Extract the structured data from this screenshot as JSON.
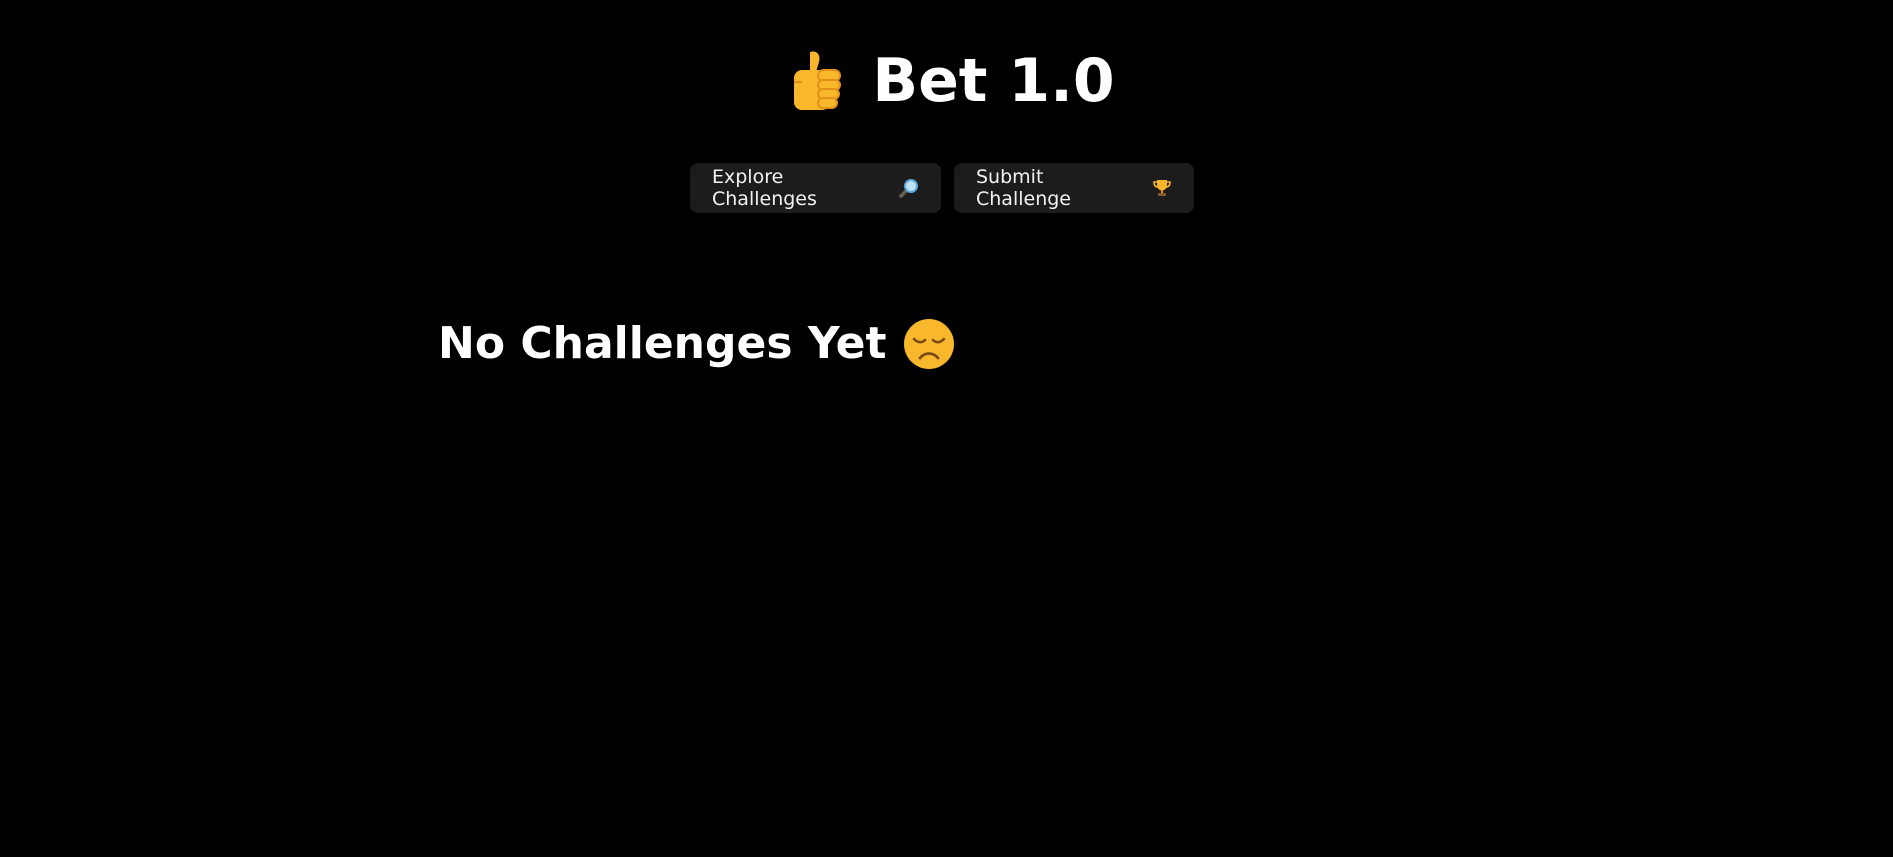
{
  "header": {
    "icon": "thumbs-up-icon",
    "title": "Bet 1.0"
  },
  "nav": {
    "explore_label": "Explore Challenges",
    "explore_icon": "magnifying-glass-icon",
    "submit_label": "Submit Challenge",
    "submit_icon": "trophy-icon"
  },
  "main": {
    "empty_title": "No Challenges Yet",
    "empty_icon": "sad-face-icon"
  },
  "colors": {
    "background": "#000000",
    "text": "#ffffff",
    "button_bg": "#1c1c1c",
    "emoji_yellow": "#f9b72b",
    "emoji_orange": "#e3901b"
  }
}
